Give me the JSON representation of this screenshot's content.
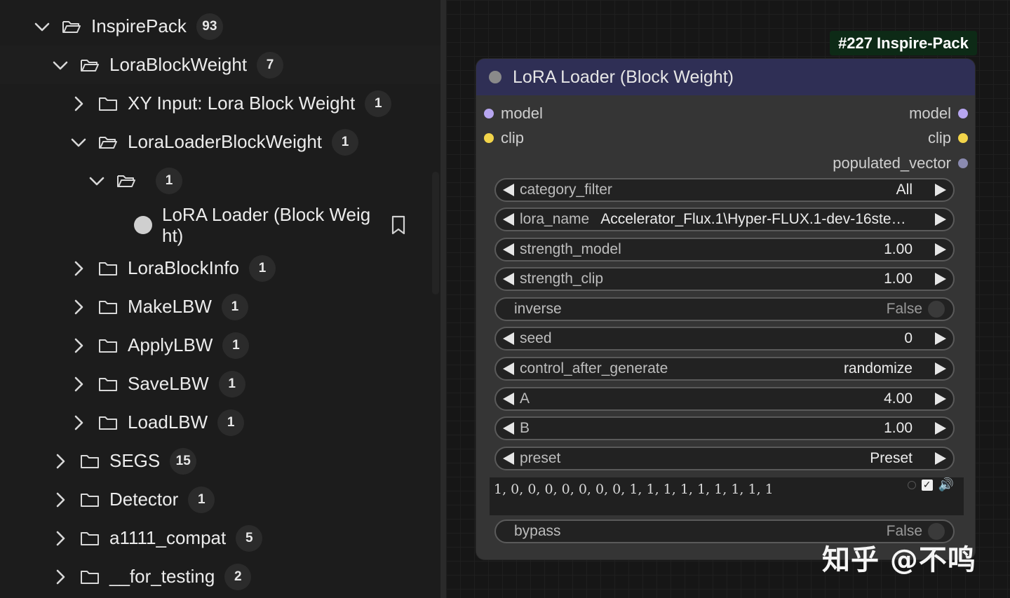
{
  "tree": {
    "rows": [
      {
        "label": "InspirePack",
        "count": "93",
        "expanded": true
      },
      {
        "label": "LoraBlockWeight",
        "count": "7",
        "expanded": true
      },
      {
        "label": "XY Input: Lora Block Weight",
        "count": "1",
        "expanded": false
      },
      {
        "label": "LoraLoaderBlockWeight",
        "count": "1",
        "expanded": true
      },
      {
        "label": "",
        "count": "1",
        "expanded": true
      },
      {
        "label": "LoraBlockInfo",
        "count": "1",
        "expanded": false
      },
      {
        "label": "MakeLBW",
        "count": "1",
        "expanded": false
      },
      {
        "label": "ApplyLBW",
        "count": "1",
        "expanded": false
      },
      {
        "label": "SaveLBW",
        "count": "1",
        "expanded": false
      },
      {
        "label": "LoadLBW",
        "count": "1",
        "expanded": false
      },
      {
        "label": "SEGS",
        "count": "15",
        "expanded": false
      },
      {
        "label": "Detector",
        "count": "1",
        "expanded": false
      },
      {
        "label": "a1111_compat",
        "count": "5",
        "expanded": false
      },
      {
        "label": "__for_testing",
        "count": "2",
        "expanded": false
      }
    ],
    "leaf": {
      "label": "LoRA Loader (Block Weig ht)",
      "icon": "bookmark-icon"
    }
  },
  "node": {
    "tag": "#227 Inspire-Pack",
    "title": "LoRA Loader (Block Weight)",
    "inputs": [
      {
        "name": "model",
        "color": "#b7a6f0"
      },
      {
        "name": "clip",
        "color": "#f2d44a"
      }
    ],
    "outputs": [
      {
        "name": "model",
        "color": "#b7a6f0"
      },
      {
        "name": "clip",
        "color": "#f2d44a"
      },
      {
        "name": "populated_vector",
        "color": "#8a8ab0"
      }
    ],
    "widgets": [
      {
        "name": "category_filter",
        "value": "All",
        "type": "combo"
      },
      {
        "name": "lora_name",
        "value": "Accelerator_Flux.1\\Hyper-FLUX.1-dev-16ste…",
        "type": "combo"
      },
      {
        "name": "strength_model",
        "value": "1.00",
        "type": "number"
      },
      {
        "name": "strength_clip",
        "value": "1.00",
        "type": "number"
      },
      {
        "name": "inverse",
        "value": "False",
        "type": "toggle"
      },
      {
        "name": "seed",
        "value": "0",
        "type": "number"
      },
      {
        "name": "control_after_generate",
        "value": "randomize",
        "type": "combo"
      },
      {
        "name": "A",
        "value": "4.00",
        "type": "number"
      },
      {
        "name": "B",
        "value": "1.00",
        "type": "number"
      },
      {
        "name": "preset",
        "value": "Preset",
        "type": "combo"
      }
    ],
    "vector_text": "1, 0, 0, 0, 0, 0, 0, 0, 1, 1, 1, 1, 1, 1, 1, 1, 1",
    "bypass": {
      "name": "bypass",
      "value": "False"
    }
  },
  "watermark": "知乎 @不鸣"
}
